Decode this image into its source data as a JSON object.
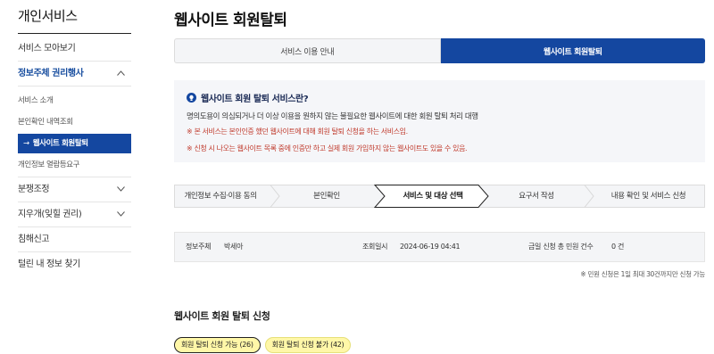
{
  "sidebar": {
    "title": "개인서비스",
    "items": [
      {
        "label": "서비스 모아보기"
      },
      {
        "label": "정보주체 권리행사"
      },
      {
        "label": "분쟁조정"
      },
      {
        "label": "지우개(잊힐 권리)"
      },
      {
        "label": "침해신고"
      },
      {
        "label": "털린 내 정보 찾기"
      }
    ],
    "subitems": [
      {
        "label": "서비스 소개"
      },
      {
        "label": "본인확인 내역조회"
      },
      {
        "label": "웹사이트 회원탈퇴",
        "arrow": "→"
      },
      {
        "label": "개인정보 열람등요구"
      }
    ]
  },
  "page": {
    "title": "웹사이트 회원탈퇴"
  },
  "tabs": [
    {
      "label": "서비스 이용 안내"
    },
    {
      "label": "웹사이트 회원탈퇴"
    }
  ],
  "info": {
    "heading": "웹사이트 회원 탈퇴 서비스란?",
    "icon": "bulb-icon",
    "line": "명의도용이 의심되거나 더 이상 이용을 원하지 않는 불필요한 웹사이트에 대한 회원 탈퇴 처리 대행",
    "note1": "※ 본 서비스는 본인인증 했던 웹사이트에 대해 회원 탈퇴 신청을 하는 서비스임.",
    "note2": "※ 신청 시 나오는 웹사이트 목록 중에 인증만 하고 실제 회원 가입하지 않는 웹사이트도 있을 수 있음."
  },
  "steps": [
    {
      "label": "개인정보 수집·이용 동의"
    },
    {
      "label": "본인확인"
    },
    {
      "label": "서비스 및 대상 선택"
    },
    {
      "label": "요구서 작성"
    },
    {
      "label": "내용 확인 및 서비스 신청"
    }
  ],
  "status": {
    "subject_label": "정보주체",
    "subject_value": "박세아",
    "date_label": "조회일시",
    "date_value": "2024-06-19 04:41",
    "count_label": "금일 신청 총 민원 건수",
    "count_value": "0 건"
  },
  "footnote": "※ 민원 신청은 1일 최대 30건까지만 신청 가능",
  "section": {
    "title": "웹사이트 회원 탈퇴 신청"
  },
  "filters": [
    {
      "label": "회원 탈퇴 신청 가능 (26)"
    },
    {
      "label": "회원 탈퇴 신청 불가 (42)"
    }
  ],
  "colors": {
    "primary": "#1447a0",
    "warning": "#c0392b",
    "highlight": "#fff7a8"
  }
}
